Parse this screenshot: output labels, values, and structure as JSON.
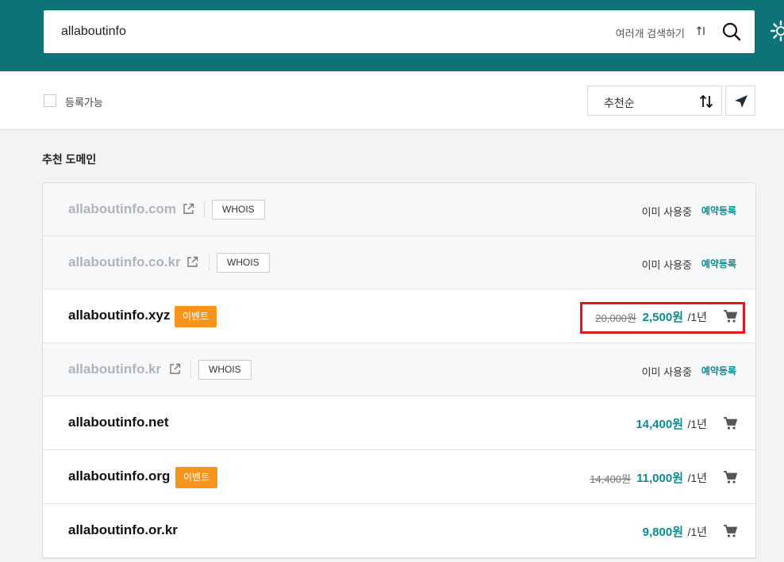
{
  "search": {
    "value": "allaboutinfo",
    "multi_search_label": "여러개 검색하기"
  },
  "filter": {
    "available_label": "등록가능",
    "sort_label": "추천순"
  },
  "section_title": "추천 도메인",
  "labels": {
    "whois": "WHOIS",
    "event": "이벤트",
    "in_use": "이미 사용중",
    "reserve": "예약등록",
    "period": "/1년"
  },
  "domains": [
    {
      "name": "allaboutinfo.com",
      "state": "in_use"
    },
    {
      "name": "allaboutinfo.co.kr",
      "state": "in_use"
    },
    {
      "name": "allaboutinfo.xyz",
      "state": "event",
      "old_price": "20,000원",
      "price": "2,500원"
    },
    {
      "name": "allaboutinfo.kr",
      "state": "in_use"
    },
    {
      "name": "allaboutinfo.net",
      "state": "available",
      "price": "14,400원"
    },
    {
      "name": "allaboutinfo.org",
      "state": "event",
      "old_price": "14,400원",
      "price": "11,000원"
    },
    {
      "name": "allaboutinfo.or.kr",
      "state": "available",
      "price": "9,800원"
    }
  ],
  "colors": {
    "header": "#0d7377",
    "accent": "#0d8a8f",
    "event_badge": "#f7941d",
    "highlight_box": "#e0161d"
  }
}
